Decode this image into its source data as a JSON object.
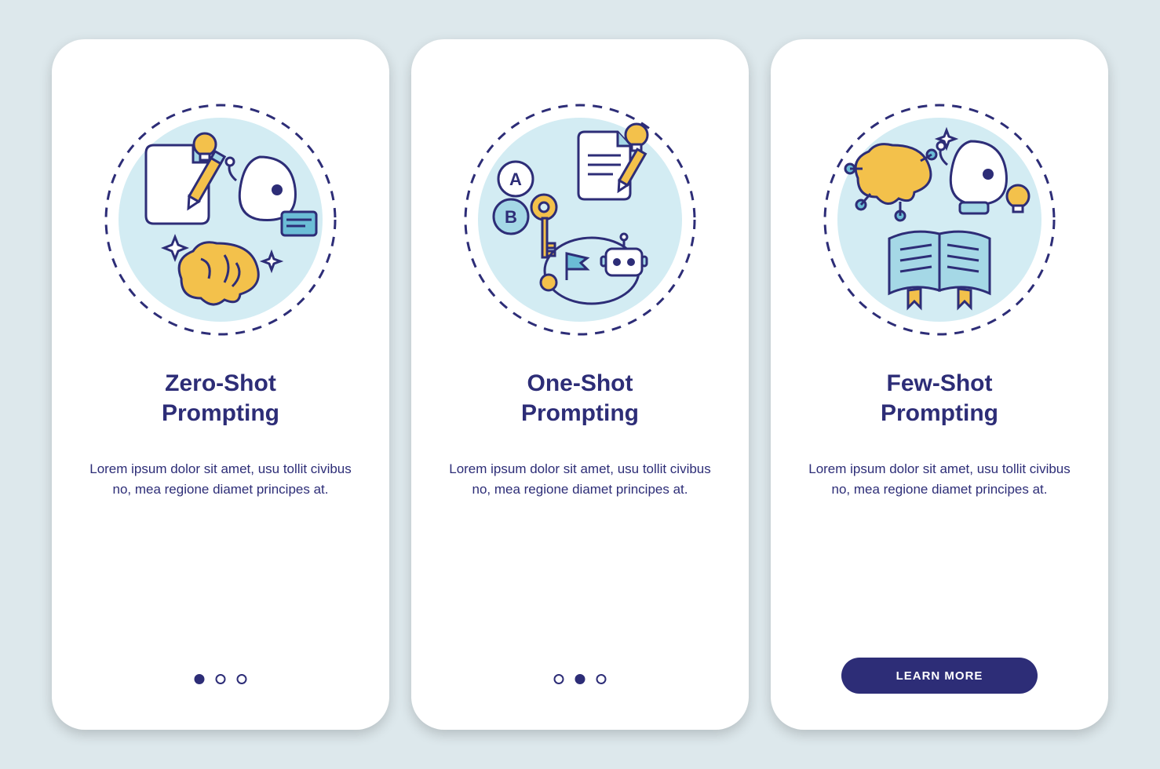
{
  "cards": [
    {
      "title": "Zero-Shot\nPrompting",
      "desc": "Lorem ipsum dolor sit amet, usu tollit civibus no, mea regione diamet principes at.",
      "footer": "dots",
      "active_dot": 0
    },
    {
      "title": "One-Shot\nPrompting",
      "desc": "Lorem ipsum dolor sit amet, usu tollit civibus no, mea regione diamet principes at.",
      "footer": "dots",
      "active_dot": 1
    },
    {
      "title": "Few-Shot\nPrompting",
      "desc": "Lorem ipsum dolor sit amet, usu tollit civibus no, mea regione diamet principes at.",
      "footer": "button",
      "button_label": "LEARN MORE"
    }
  ],
  "colors": {
    "navy": "#2d2d77",
    "yellow": "#f3c14b",
    "lightblue": "#a5d8e6",
    "paleblue": "#d3ecf3",
    "blue": "#6bbdd6"
  }
}
